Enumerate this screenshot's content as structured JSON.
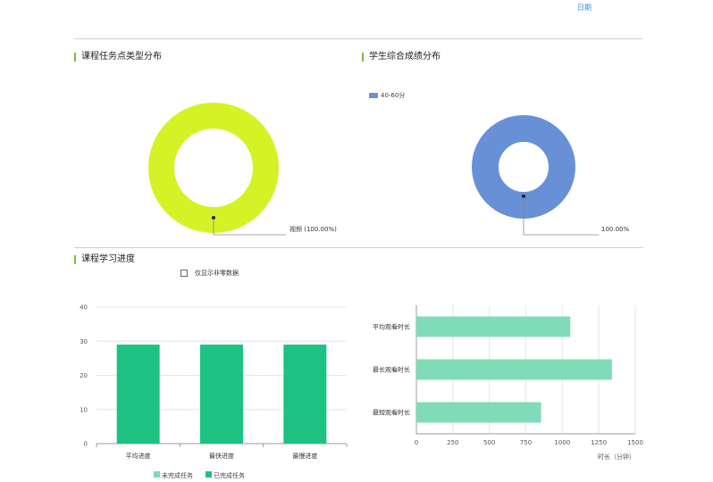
{
  "header": {
    "date_link": "日期"
  },
  "sections": {
    "task_types": {
      "title": "课程任务点类型分布"
    },
    "scores": {
      "title": "学生综合成绩分布"
    },
    "progress": {
      "title": "课程学习进度",
      "filter_label": "仅显示非零数据"
    }
  },
  "colors": {
    "accent": "#7dbb3a",
    "lime": "#d4f226",
    "blue": "#6890d6",
    "green": "#1dc283",
    "light_green": "#80dcb8"
  },
  "chart_data": [
    {
      "id": "task-type-donut",
      "type": "pie",
      "slices": [
        {
          "label": "视频",
          "value": 100,
          "display": "视频 (100.00%)",
          "color": "#d4f226"
        }
      ]
    },
    {
      "id": "score-donut",
      "type": "pie",
      "legend": [
        {
          "label": "40-60分",
          "color": "#6890d6"
        }
      ],
      "slices": [
        {
          "label": "40-60分",
          "value": 100,
          "display": "100.00%",
          "color": "#6890d6"
        }
      ]
    },
    {
      "id": "progress-bar",
      "type": "bar",
      "categories": [
        "平均进度",
        "最快进度",
        "最慢进度"
      ],
      "series": [
        {
          "name": "未完成任务",
          "color": "#80dcb8",
          "values": [
            0,
            0,
            0
          ]
        },
        {
          "name": "已完成任务",
          "color": "#1dc283",
          "values": [
            29,
            29,
            29
          ]
        }
      ],
      "ylim": [
        0,
        40
      ],
      "yticks": [
        0,
        10,
        20,
        30,
        40
      ]
    },
    {
      "id": "watch-time-bar",
      "type": "bar",
      "orientation": "horizontal",
      "categories": [
        "平均观看时长",
        "最长观看时长",
        "最短观看时长"
      ],
      "values": [
        1055,
        1340,
        855
      ],
      "xlim": [
        0,
        1500
      ],
      "xticks": [
        0,
        250,
        500,
        750,
        1000,
        1250,
        1500
      ],
      "xlabel": "时长（分钟）",
      "color": "#80dcb8"
    }
  ]
}
